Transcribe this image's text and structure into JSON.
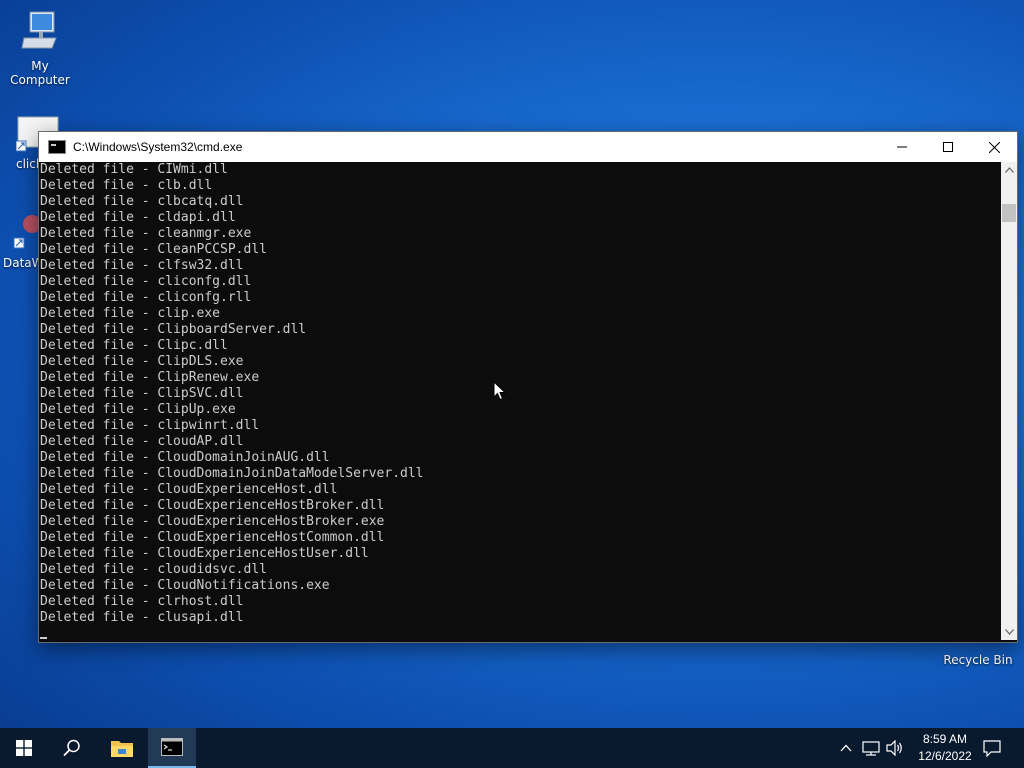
{
  "desktop": {
    "icons": {
      "my_computer": "My Computer",
      "recycle_bin": "Recycle Bin",
      "partial_1": "click",
      "partial_2": "DataW"
    }
  },
  "window": {
    "title": "C:\\Windows\\System32\\cmd.exe",
    "console_lines": [
      "Deleted file - CIWmi.dll",
      "Deleted file - clb.dll",
      "Deleted file - clbcatq.dll",
      "Deleted file - cldapi.dll",
      "Deleted file - cleanmgr.exe",
      "Deleted file - CleanPCCSP.dll",
      "Deleted file - clfsw32.dll",
      "Deleted file - cliconfg.dll",
      "Deleted file - cliconfg.rll",
      "Deleted file - clip.exe",
      "Deleted file - ClipboardServer.dll",
      "Deleted file - Clipc.dll",
      "Deleted file - ClipDLS.exe",
      "Deleted file - ClipRenew.exe",
      "Deleted file - ClipSVC.dll",
      "Deleted file - ClipUp.exe",
      "Deleted file - clipwinrt.dll",
      "Deleted file - cloudAP.dll",
      "Deleted file - CloudDomainJoinAUG.dll",
      "Deleted file - CloudDomainJoinDataModelServer.dll",
      "Deleted file - CloudExperienceHost.dll",
      "Deleted file - CloudExperienceHostBroker.dll",
      "Deleted file - CloudExperienceHostBroker.exe",
      "Deleted file - CloudExperienceHostCommon.dll",
      "Deleted file - CloudExperienceHostUser.dll",
      "Deleted file - cloudidsvc.dll",
      "Deleted file - CloudNotifications.exe",
      "Deleted file - clrhost.dll",
      "Deleted file - clusapi.dll"
    ]
  },
  "taskbar": {
    "clock": {
      "time": "8:59 AM",
      "date": "12/6/2022"
    }
  },
  "colors": {
    "console_bg": "#0c0c0c",
    "console_text": "#cccccc",
    "taskbar_bg": "#0a1a2e",
    "accent": "#76b9ed"
  },
  "icon_names": [
    "computer-icon",
    "recycle-bin-icon",
    "shortcut-icon",
    "cmd-icon",
    "minimize-icon",
    "maximize-icon",
    "close-icon",
    "start-icon",
    "search-icon",
    "file-explorer-icon",
    "chevron-up-icon",
    "network-icon",
    "volume-icon",
    "notification-icon",
    "mouse-cursor-icon"
  ]
}
